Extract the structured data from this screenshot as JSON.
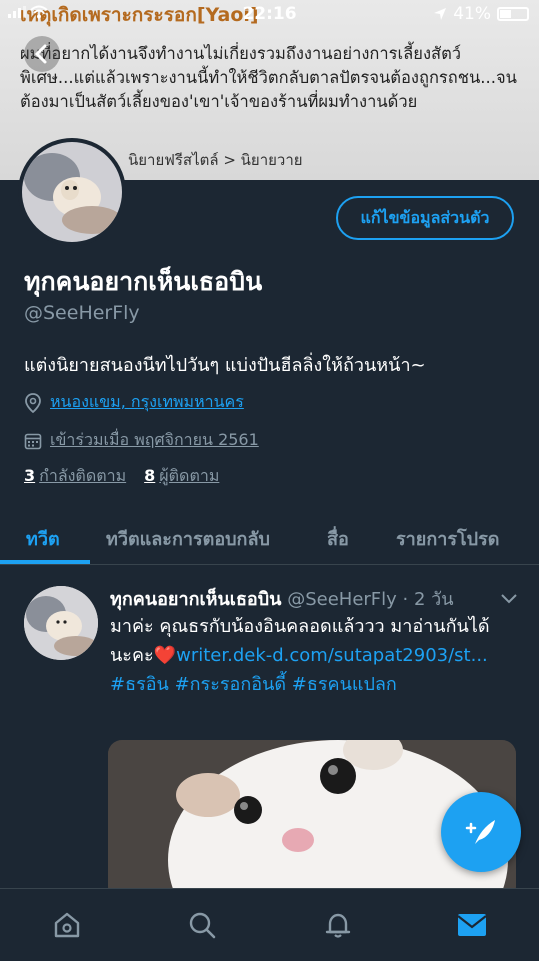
{
  "status_bar": {
    "time": "22:16",
    "battery": "41%",
    "battery_level": 0.41
  },
  "banner": {
    "title": "เหตุเกิดเพราะกระรอก[Yaoi]",
    "synopsis": "ผมที่อยากได้งานจึงทำงานไม่เกี่ยงรวมถึงงานอย่างการเลี้ยงสัตว์พิเศษ...แต่แล้วเพราะงานนี้ทำให้ชีวิตกลับตาลปัตรจนต้องถูกรถชน...จนต้องมาเป็นสัตว์เลี้ยงของ'เขา'เจ้าของร้านที่ผมทำงานด้วย",
    "category": "นิยายฟรีสไตล์ > นิยายวาย"
  },
  "profile": {
    "edit_button": "แก้ไขข้อมูลส่วนตัว",
    "name": "ทุกคนอยากเห็นเธอบิน",
    "handle": "@SeeHerFly",
    "bio": "แต่งนิยายสนองนีทไปวันๆ แบ่งปันฮีลลิ่งให้ถ้วนหน้า~",
    "location": "หนองแขม, กรุงเทพมหานคร",
    "joined": "เข้าร่วมเมื่อ พฤศจิกายน 2561",
    "following_count": "3",
    "following_label": "กำลังติดตาม",
    "followers_count": "8",
    "followers_label": "ผู้ติดตาม"
  },
  "tabs": [
    {
      "label": "ทวีต",
      "active": true
    },
    {
      "label": "ทวีตและการตอบกลับ",
      "active": false
    },
    {
      "label": "สื่อ",
      "active": false
    },
    {
      "label": "รายการโปรด",
      "active": false
    }
  ],
  "tweet": {
    "name": "ทุกคนอยากเห็นเธอบิน",
    "handle": "@SeeHerFly",
    "time": "· 2 วัน",
    "text": "มาค่ะ คุณธรกับน้องอินคลอดแล้ววว มาอ่านกันได้นะคะ",
    "heart": "❤️",
    "link": "writer.dek-d.com/sutapat2903/st...",
    "hashtags": "#ธรอิน #กระรอกอินดี้ #ธรคนแปลก"
  },
  "colors": {
    "accent": "#1da1f2",
    "background": "#1c2733",
    "secondary_text": "#8899a6"
  },
  "icons": {
    "bottom_nav": [
      "home-icon",
      "search-icon",
      "notifications-icon",
      "messages-icon"
    ],
    "fab": "compose-tweet-icon"
  }
}
